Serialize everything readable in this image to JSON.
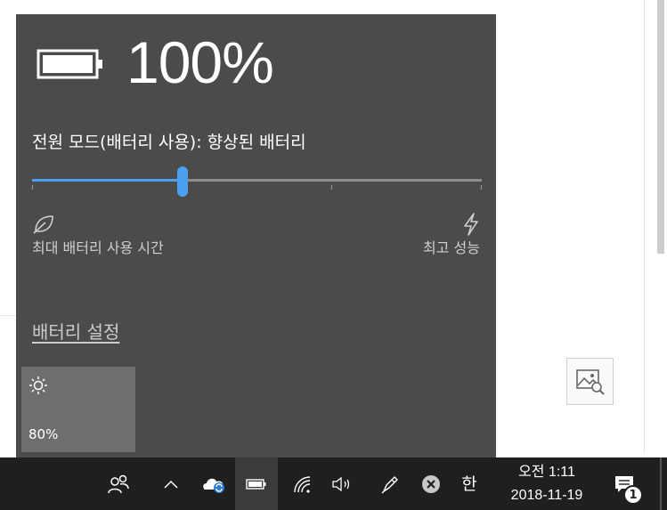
{
  "battery": {
    "percent_text": "100%",
    "power_mode_label": "전원 모드(배터리 사용): 향상된 배터리",
    "slider": {
      "level": 0.33,
      "min_label": "최대 배터리 사용 시간",
      "max_label": "최고 성능"
    },
    "settings_link": "배터리 설정",
    "brightness": {
      "value": "80%"
    }
  },
  "taskbar": {
    "ime_label": "한",
    "clock_time": "오전 1:11",
    "clock_date": "2018-11-19",
    "notification_count": "1"
  },
  "icons": {
    "battery": "battery-full-icon",
    "leaf": "leaf-icon",
    "bolt": "lightning-bolt-icon",
    "brightness": "sun-icon",
    "people": "people-icon",
    "chevron": "chevron-up-icon",
    "onedrive": "onedrive-sync-icon",
    "tray_battery": "battery-icon",
    "wifi": "wifi-icon",
    "volume": "volume-icon",
    "pen": "pen-icon",
    "close": "close-circle-icon",
    "action_center": "action-center-icon",
    "image_search": "image-search-icon"
  },
  "colors": {
    "flyout_bg": "#4b4b4b",
    "accent": "#4aa0f0",
    "taskbar_bg": "#1f1f1f"
  }
}
